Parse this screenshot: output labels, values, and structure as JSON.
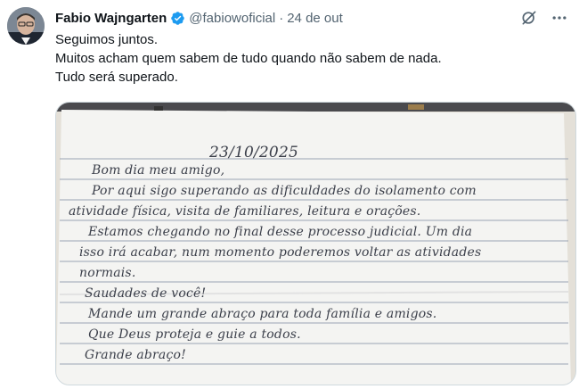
{
  "tweet": {
    "author_name": "Fabio Wajngarten",
    "handle": "@fabiowoficial",
    "separator": "·",
    "date": "24 de out",
    "text_lines": [
      "Seguimos juntos.",
      "Muitos acham quem sabem de tudo quando não sabem de nada.",
      "Tudo será superado."
    ],
    "icons": {
      "verified": "verified-badge-icon",
      "grok": "grok-icon",
      "more": "more-icon"
    },
    "colors": {
      "verified_badge": "#1d9bf0",
      "secondary_text": "#536471",
      "primary_text": "#0f1419"
    }
  },
  "letter": {
    "date": "23/10/2025",
    "lines": [
      "Bom dia meu amigo,",
      "Por aqui sigo superando as dificuldades do isolamento com",
      "atividade física, visita de familiares, leitura e orações.",
      "Estamos chegando no final desse processo judicial. Um dia",
      "isso irá acabar, num momento poderemos voltar as atividades",
      "normais.",
      "Saudades de você!",
      "Mande um grande abraço para toda família e amigos.",
      "Que Deus proteja e guie a todos.",
      "Grande abraço!"
    ]
  }
}
